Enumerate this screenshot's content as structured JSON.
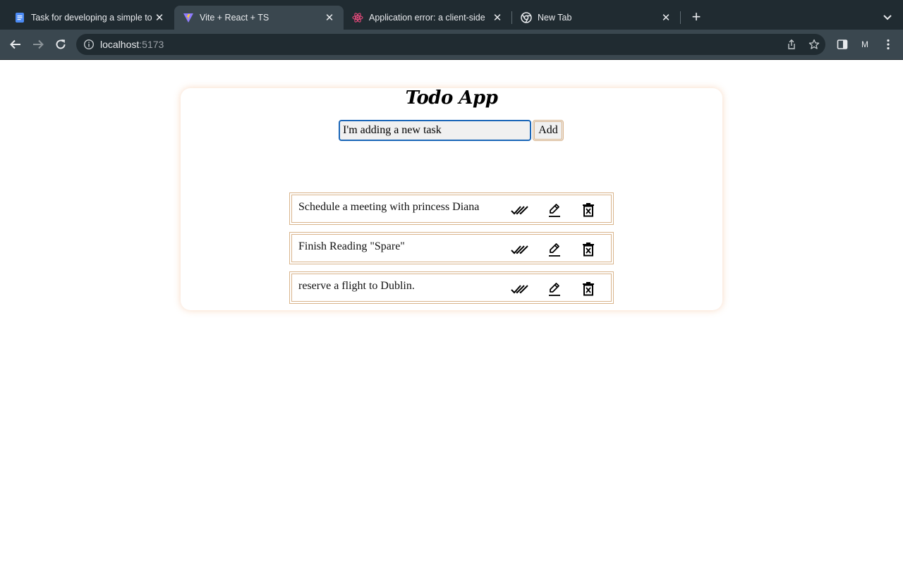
{
  "browser": {
    "tabs": [
      {
        "title": "Task for developing a simple to",
        "favicon": "google-docs-icon",
        "active": false
      },
      {
        "title": "Vite + React + TS",
        "favicon": "vite-icon",
        "active": true
      },
      {
        "title": "Application error: a client-side",
        "favicon": "react-icon",
        "active": false
      },
      {
        "title": "New Tab",
        "favicon": "chrome-icon",
        "active": false
      }
    ],
    "url_host": "localhost",
    "url_port": ":5173",
    "profile_initial": "M"
  },
  "app": {
    "title": "Todo App",
    "input_value": "I'm adding a new task",
    "add_label": "Add",
    "todos": [
      {
        "text": "Schedule a meeting with princess Diana"
      },
      {
        "text": "Finish Reading \"Spare\""
      },
      {
        "text": "reserve a flight to Dublin."
      }
    ]
  },
  "colors": {
    "tabstrip": "#202b31",
    "toolbar": "#3a474f",
    "input_focus": "#1a66b8",
    "item_border": "#d9b48c"
  }
}
